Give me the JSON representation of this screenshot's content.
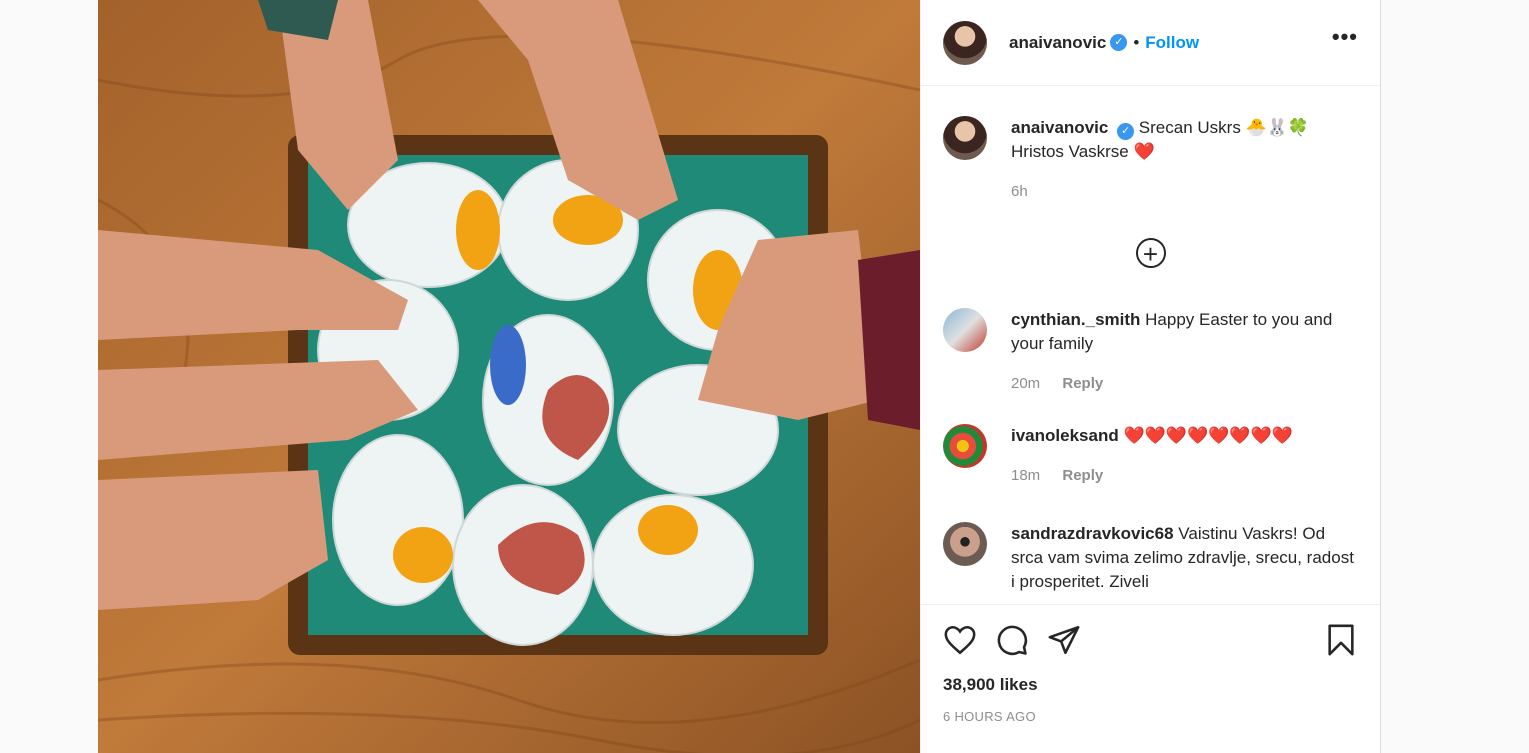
{
  "post": {
    "username": "anaivanovic",
    "follow_label": "Follow",
    "separator": "•",
    "more_label": "•••",
    "verified_label": "✓",
    "caption_line1": "Srecan Uskrs 🐣🐰🍀",
    "caption_line2": "Hristos Vaskrse ❤️",
    "caption_time": "6h",
    "load_more_label": "+",
    "likes": "38,900 likes",
    "posted_ago": "6 HOURS AGO"
  },
  "comments": [
    {
      "username": "cynthian._smith",
      "text": "Happy Easter to you and your family",
      "time": "20m",
      "reply": "Reply"
    },
    {
      "username": "ivanoleksand",
      "text": "❤️❤️❤️❤️❤️❤️❤️❤️",
      "time": "18m",
      "reply": "Reply"
    },
    {
      "username": "sandrazdravkovic68",
      "text": "Vaistinu Vaskrs! Od srca vam svima zelimo zdravlje, srecu, radost i prosperitet. Ziveli",
      "time": "",
      "reply": ""
    }
  ],
  "icons": {
    "like": "heart-icon",
    "comment": "comment-icon",
    "share": "share-icon",
    "save": "bookmark-icon",
    "more": "more-options-icon"
  },
  "colors": {
    "follow": "#0095f6",
    "verified": "#3897f0",
    "muted": "#8e8e8e",
    "text": "#262626"
  }
}
